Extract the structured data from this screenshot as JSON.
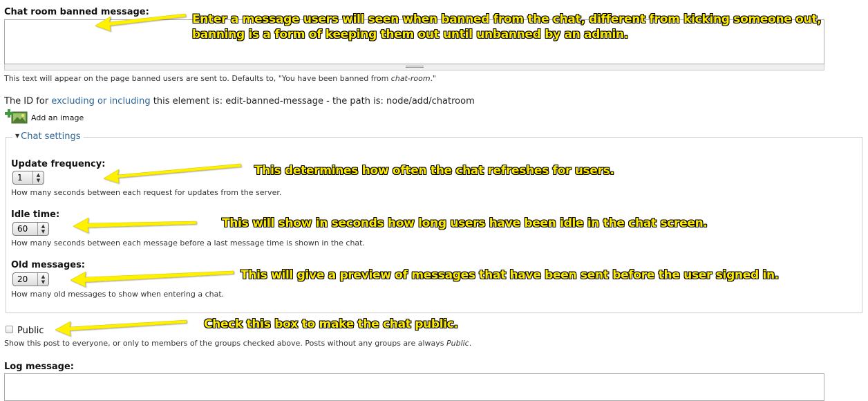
{
  "banned": {
    "label": "Chat room banned message:",
    "help_prefix": "This text will appear on the page banned users are sent to. Defaults to, \"You have been banned from ",
    "help_em": "chat-room",
    "help_suffix": ".\"",
    "value": ""
  },
  "id_line": {
    "prefix": "The ID for ",
    "link": "excluding or including",
    "suffix": " this element is: edit-banned-message - the path is: node/add/chatroom"
  },
  "add_image": {
    "label": "Add an image",
    "icon": "add-image-icon"
  },
  "chat_settings": {
    "legend": "Chat settings",
    "fields": [
      {
        "label": "Update frequency:",
        "value": "1",
        "help": "How many seconds between each request for updates from the server."
      },
      {
        "label": "Idle time:",
        "value": "60",
        "help": "How many seconds between each message before a last message time is shown in the chat."
      },
      {
        "label": "Old messages:",
        "value": "20",
        "help": "How many old messages to show when entering a chat."
      }
    ]
  },
  "public": {
    "label": "Public",
    "checked": false,
    "help_prefix": "Show this post to everyone, or only to members of the groups checked above. Posts without any groups are always ",
    "help_em": "Public",
    "help_suffix": "."
  },
  "log": {
    "label": "Log message:",
    "value": ""
  },
  "annotations": {
    "banned_line1": "Enter a message users will seen when banned from the chat, different from kicking someone out,",
    "banned_line2": "banning is a form of keeping them out until unbanned by an admin.",
    "update": "This determines how often the chat refreshes for users.",
    "idle": "This will show in seconds how long users have been idle in the chat screen.",
    "old": "This will give a preview of messages that have been sent before the user signed in.",
    "public": "Check this box to make the chat public."
  },
  "colors": {
    "annotation_text": "#ffeb00",
    "annotation_outline": "#000000",
    "arrow": "#fff200",
    "link": "#2a6496"
  }
}
